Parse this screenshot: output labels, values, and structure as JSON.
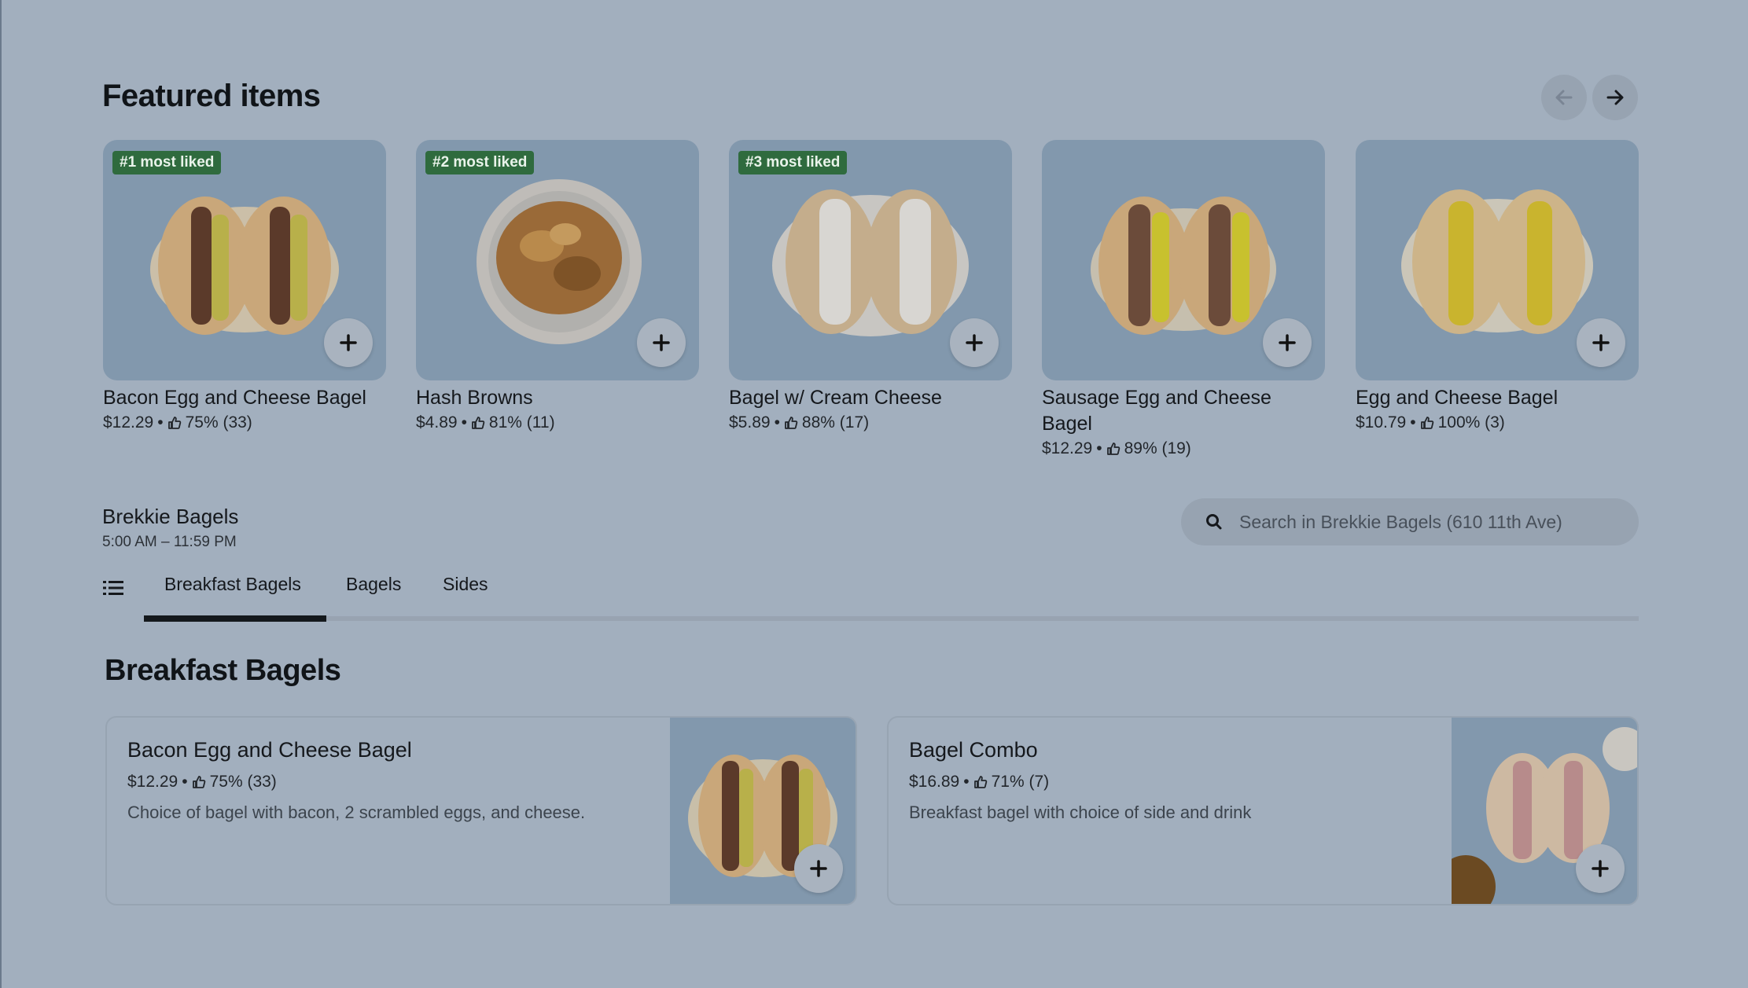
{
  "featured": {
    "title": "Featured items",
    "items": [
      {
        "badge": "#1 most liked",
        "name": "Bacon Egg and Cheese Bagel",
        "price": "$12.29",
        "rating": "75% (33)"
      },
      {
        "badge": "#2 most liked",
        "name": "Hash Browns",
        "price": "$4.89",
        "rating": "81% (11)"
      },
      {
        "badge": "#3 most liked",
        "name": "Bagel w/ Cream Cheese",
        "price": "$5.89",
        "rating": "88% (17)"
      },
      {
        "badge": "",
        "name": "Sausage Egg and Cheese Bagel",
        "price": "$12.29",
        "rating": "89% (19)"
      },
      {
        "badge": "",
        "name": "Egg and Cheese Bagel",
        "price": "$10.79",
        "rating": "100% (3)"
      }
    ]
  },
  "store": {
    "name": "Brekkie Bagels",
    "hours": "5:00 AM – 11:59 PM",
    "search_placeholder": "Search in Brekkie Bagels (610 11th Ave)"
  },
  "tabs": [
    {
      "label": "Breakfast Bagels",
      "active": true
    },
    {
      "label": "Bagels",
      "active": false
    },
    {
      "label": "Sides",
      "active": false
    }
  ],
  "section": {
    "title": "Breakfast Bagels",
    "items": [
      {
        "name": "Bacon Egg and Cheese Bagel",
        "price": "$12.29",
        "rating": "75% (33)",
        "description": "Choice of bagel with bacon, 2 scrambled eggs, and cheese."
      },
      {
        "name": "Bagel Combo",
        "price": "$16.89",
        "rating": "71% (7)",
        "description": "Breakfast bagel with choice of side and drink"
      }
    ]
  },
  "meta_separator": "•",
  "colors": {
    "badge_bg": "#2f6b3e",
    "overlay_bg": "#a2afbe"
  }
}
